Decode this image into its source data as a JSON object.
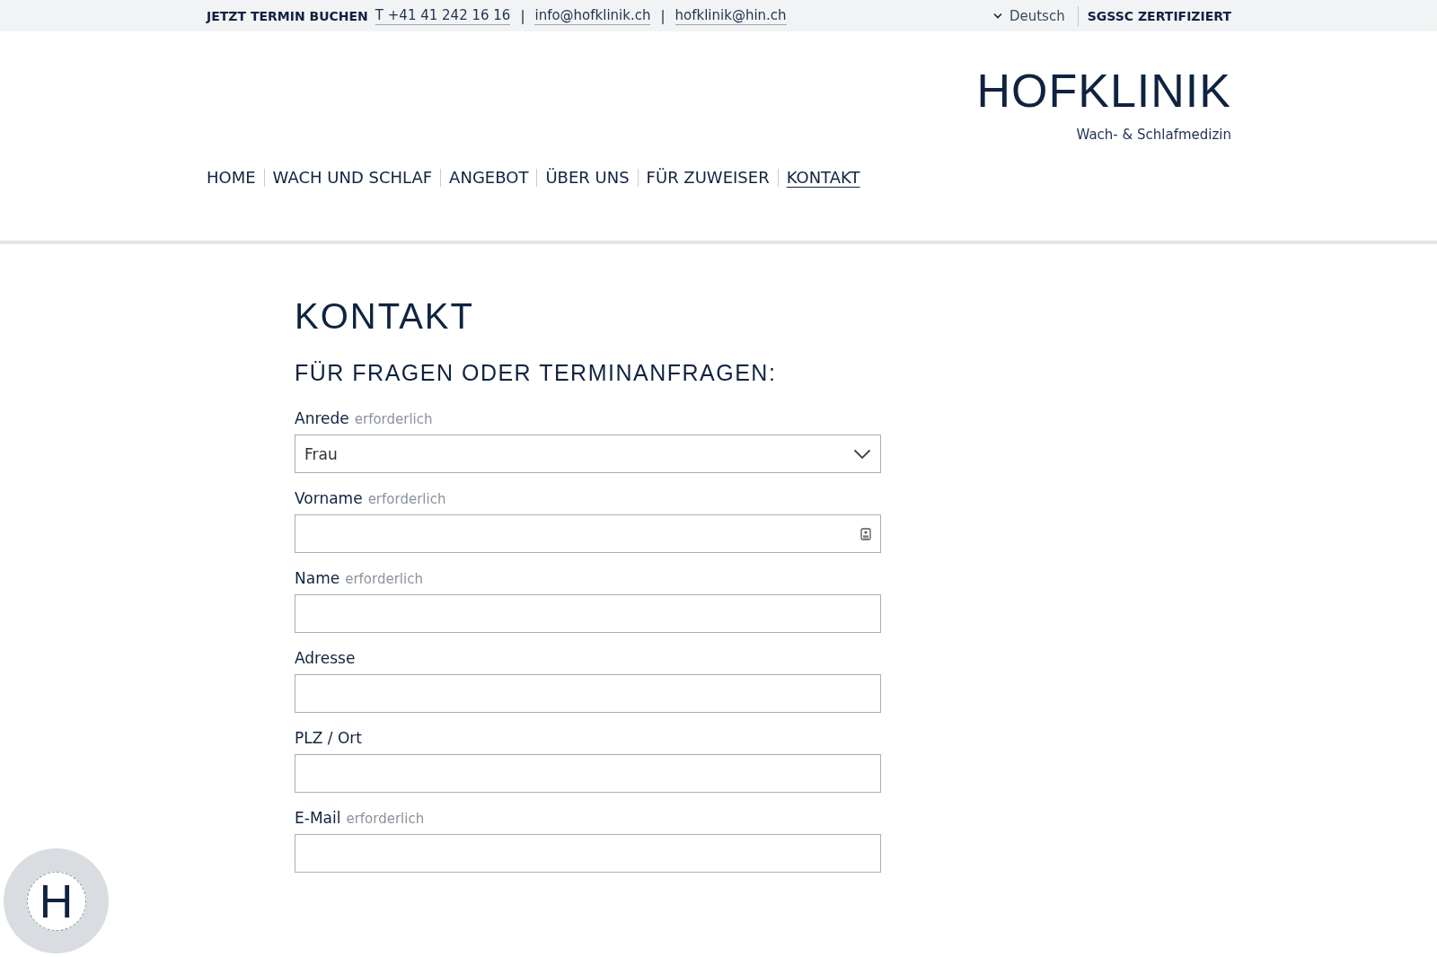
{
  "top_bar": {
    "cta": "JETZT TERMIN BUCHEN",
    "phone": "T +41 41 242 16 16",
    "links": [
      "info@hofklinik.ch",
      "hofklinik@hin.ch"
    ],
    "separator": "|",
    "language": "Deutsch",
    "certification": "SGSSC ZERTIFIZIERT"
  },
  "logo": {
    "name": "HOFKLINIK",
    "tagline": "Wach- & Schlafmedizin"
  },
  "nav": [
    {
      "label": "HOME",
      "selected": false
    },
    {
      "label": "WACH UND SCHLAF",
      "selected": false
    },
    {
      "label": "ANGEBOT",
      "selected": false
    },
    {
      "label": "ÜBER UNS",
      "selected": false
    },
    {
      "label": "FÜR ZUWEISER",
      "selected": false
    },
    {
      "label": "KONTAKT",
      "selected": true
    }
  ],
  "page": {
    "title": "KONTAKT",
    "subtitle": "FÜR FRAGEN ODER TERMINANFRAGEN:"
  },
  "form": [
    {
      "kind": "select",
      "label": "Anrede",
      "hint": "erforderlich",
      "value": "Frau"
    },
    {
      "kind": "contact",
      "label": "Vorname",
      "hint": "erforderlich"
    },
    {
      "kind": "text",
      "label": "Name",
      "hint": "erforderlich"
    },
    {
      "kind": "text",
      "label": "Adresse"
    },
    {
      "kind": "text",
      "label": "PLZ / Ort"
    },
    {
      "kind": "text",
      "label": "E-Mail",
      "hint": "erforderlich"
    }
  ],
  "badge": {
    "letter": "H"
  }
}
